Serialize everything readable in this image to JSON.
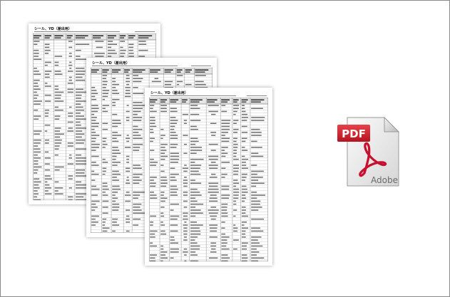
{
  "documents": [
    {
      "title": "シール、YD（差出用）"
    },
    {
      "title": "シール、YD（差出用）"
    },
    {
      "title": "シール、YD（差出用）"
    }
  ],
  "pdf_icon": {
    "badge_text": "PDF",
    "brand_text": "Adobe",
    "badge_color": "#d2202f",
    "logo_color": "#c8102e"
  }
}
